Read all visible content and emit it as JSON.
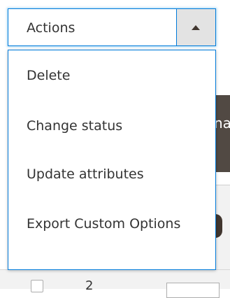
{
  "actions": {
    "label": "Actions",
    "menu_items": [
      {
        "label": "Delete"
      },
      {
        "label": "Change status"
      },
      {
        "label": "Update attributes"
      },
      {
        "label": "Export Custom Options"
      }
    ]
  },
  "background": {
    "partial_header_text": "na",
    "row_partial_text": "2"
  },
  "colors": {
    "accent_border": "#007bdb",
    "toggle_bg": "#e3e3e3",
    "text": "#333333",
    "dark_band": "#514943"
  },
  "icons": {
    "toggle": "caret-up-icon"
  }
}
